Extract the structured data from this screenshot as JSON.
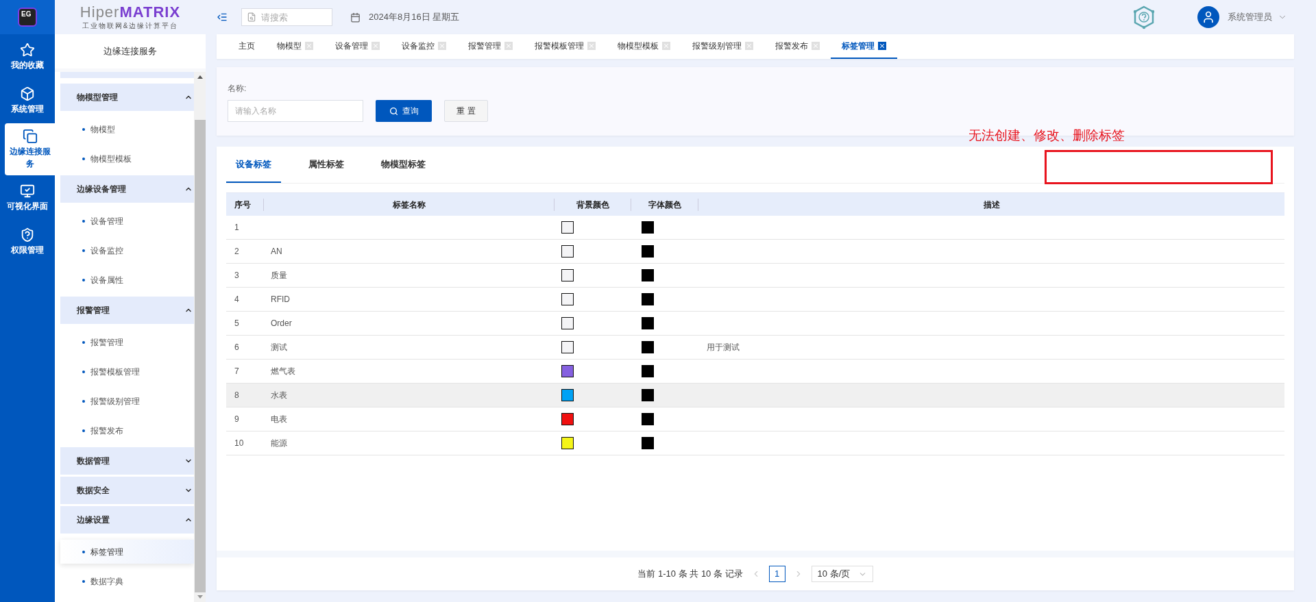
{
  "logo": {
    "icon_text": "EG",
    "brand": "Hiper",
    "brand_accent": "MATRIX",
    "subtitle": "工业物联网&边缘计算平台"
  },
  "rail": [
    {
      "kind": "star",
      "label": "我的收藏",
      "selected": false
    },
    {
      "kind": "cube",
      "label": "系统管理",
      "selected": false
    },
    {
      "kind": "link",
      "label": "边缘连接服务",
      "selected": true
    },
    {
      "kind": "screen",
      "label": "可视化界面",
      "selected": false
    },
    {
      "kind": "shield",
      "label": "权限管理",
      "selected": false
    }
  ],
  "sidebar": {
    "title": "边缘连接服务",
    "groups": [
      {
        "label": "物模型管理",
        "expanded": true,
        "items": [
          {
            "label": "物模型",
            "selected": false
          },
          {
            "label": "物模型模板",
            "selected": false
          }
        ]
      },
      {
        "label": "边缘设备管理",
        "expanded": true,
        "items": [
          {
            "label": "设备管理",
            "selected": false
          },
          {
            "label": "设备监控",
            "selected": false
          },
          {
            "label": "设备属性",
            "selected": false
          }
        ]
      },
      {
        "label": "报警管理",
        "expanded": true,
        "items": [
          {
            "label": "报警管理",
            "selected": false
          },
          {
            "label": "报警模板管理",
            "selected": false
          },
          {
            "label": "报警级别管理",
            "selected": false
          },
          {
            "label": "报警发布",
            "selected": false
          }
        ]
      },
      {
        "label": "数据管理",
        "expanded": false
      },
      {
        "label": "数据安全",
        "expanded": false
      },
      {
        "label": "边缘设置",
        "expanded": true,
        "items": [
          {
            "label": "标签管理",
            "selected": true
          },
          {
            "label": "数据字典",
            "selected": false
          }
        ]
      }
    ]
  },
  "topbar": {
    "search_placeholder": "请搜索",
    "date": "2024年8月16日 星期五",
    "user": "系统管理员"
  },
  "page_tabs": [
    {
      "label": "主页",
      "closable": false,
      "selected": false
    },
    {
      "label": "物模型",
      "closable": true,
      "selected": false
    },
    {
      "label": "设备管理",
      "closable": true,
      "selected": false
    },
    {
      "label": "设备监控",
      "closable": true,
      "selected": false
    },
    {
      "label": "报警管理",
      "closable": true,
      "selected": false
    },
    {
      "label": "报警模板管理",
      "closable": true,
      "selected": false
    },
    {
      "label": "物模型模板",
      "closable": true,
      "selected": false
    },
    {
      "label": "报警级别管理",
      "closable": true,
      "selected": false
    },
    {
      "label": "报警发布",
      "closable": true,
      "selected": false
    },
    {
      "label": "标签管理",
      "closable": true,
      "selected": true
    }
  ],
  "filter": {
    "label": "名称:",
    "placeholder": "请输入名称",
    "search_button": "查询",
    "reset_button": "重 置"
  },
  "panel_tabs": [
    {
      "label": "设备标签",
      "selected": true
    },
    {
      "label": "属性标签",
      "selected": false
    },
    {
      "label": "物模型标签",
      "selected": false
    }
  ],
  "annotation": {
    "text": "无法创建、修改、删除标签"
  },
  "table": {
    "columns": [
      "序号",
      "标签名称",
      "背景颜色",
      "字体颜色",
      "描述"
    ],
    "rows": [
      {
        "index": "1",
        "background": {
          "color": "#f4f4f6"
        },
        "font": {
          "color": "#000000"
        },
        "hovered": false
      },
      {
        "index": "2",
        "name": "AN",
        "background": {
          "color": "#f4f4f6"
        },
        "font": {
          "color": "#000000"
        },
        "hovered": false
      },
      {
        "index": "3",
        "name": "质量",
        "background": {
          "color": "#f4f4f6"
        },
        "font": {
          "color": "#000000"
        },
        "hovered": false
      },
      {
        "index": "4",
        "name": "RFID",
        "background": {
          "color": "#f4f4f6"
        },
        "font": {
          "color": "#000000"
        },
        "hovered": false
      },
      {
        "index": "5",
        "name": "Order",
        "background": {
          "color": "#f4f4f6"
        },
        "font": {
          "color": "#000000"
        },
        "hovered": false
      },
      {
        "index": "6",
        "name": "测试",
        "background": {
          "color": "#f4f4f6"
        },
        "font": {
          "color": "#000000"
        },
        "description": "用于测试",
        "hovered": false
      },
      {
        "index": "7",
        "name": "燃气表",
        "background": {
          "color": "#8560e0"
        },
        "font": {
          "color": "#000000"
        },
        "hovered": false
      },
      {
        "index": "8",
        "name": "水表",
        "background": {
          "color": "#00a2f5"
        },
        "font": {
          "color": "#000000"
        },
        "hovered": true
      },
      {
        "index": "9",
        "name": "电表",
        "background": {
          "color": "#f01010"
        },
        "font": {
          "color": "#000000"
        },
        "hovered": false
      },
      {
        "index": "10",
        "name": "能源",
        "background": {
          "color": "#f5f518"
        },
        "font": {
          "color": "#000000"
        },
        "hovered": false
      }
    ]
  },
  "pagination": {
    "summary": "当前 1-10 条 共 10 条 记录",
    "pages": [
      {
        "label": "1",
        "selected": true
      }
    ],
    "page_size": "10 条/页"
  }
}
